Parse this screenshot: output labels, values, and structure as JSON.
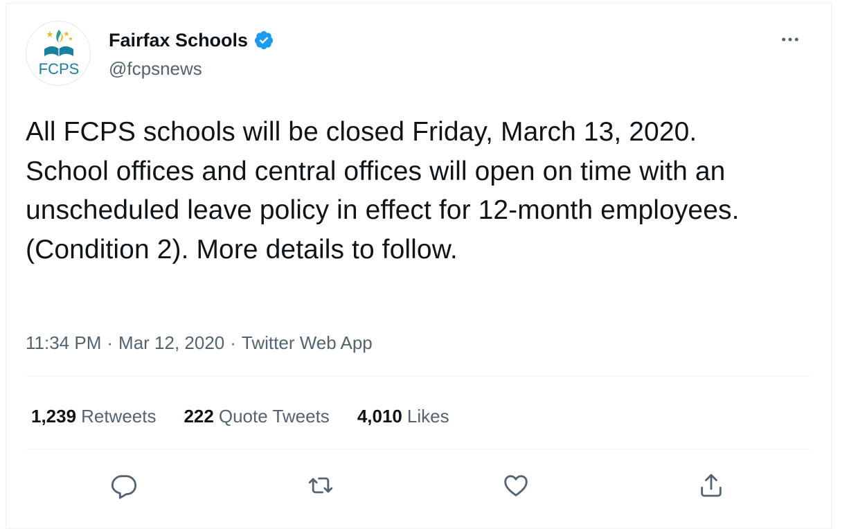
{
  "author": {
    "display_name": "Fairfax Schools",
    "handle": "@fcpsnews",
    "avatar_text": "FCPS",
    "verified": true
  },
  "tweet": {
    "line1": "All FCPS schools will be closed Friday, March 13, 2020.",
    "line2": "School offices and central offices will open on time with an unscheduled leave policy in effect for 12-month employees. (Condition 2). More details to follow."
  },
  "meta": {
    "time": "11:34 PM",
    "separator": "·",
    "date": "Mar 12, 2020",
    "source": "Twitter Web App"
  },
  "stats": {
    "retweets_count": "1,239",
    "retweets_label": "Retweets",
    "quotes_count": "222",
    "quotes_label": "Quote Tweets",
    "likes_count": "4,010",
    "likes_label": "Likes"
  },
  "icons": {
    "more": "more-dots-icon",
    "reply": "reply-icon",
    "retweet": "retweet-icon",
    "like": "heart-icon",
    "share": "share-icon",
    "verified": "verified-badge-icon"
  },
  "colors": {
    "text_primary": "#0f1419",
    "text_secondary": "#536471",
    "verified_blue": "#1d9bf0",
    "divider": "#eff3f4",
    "logo_teal": "#1b7fa0",
    "logo_gold": "#e8b52a"
  }
}
